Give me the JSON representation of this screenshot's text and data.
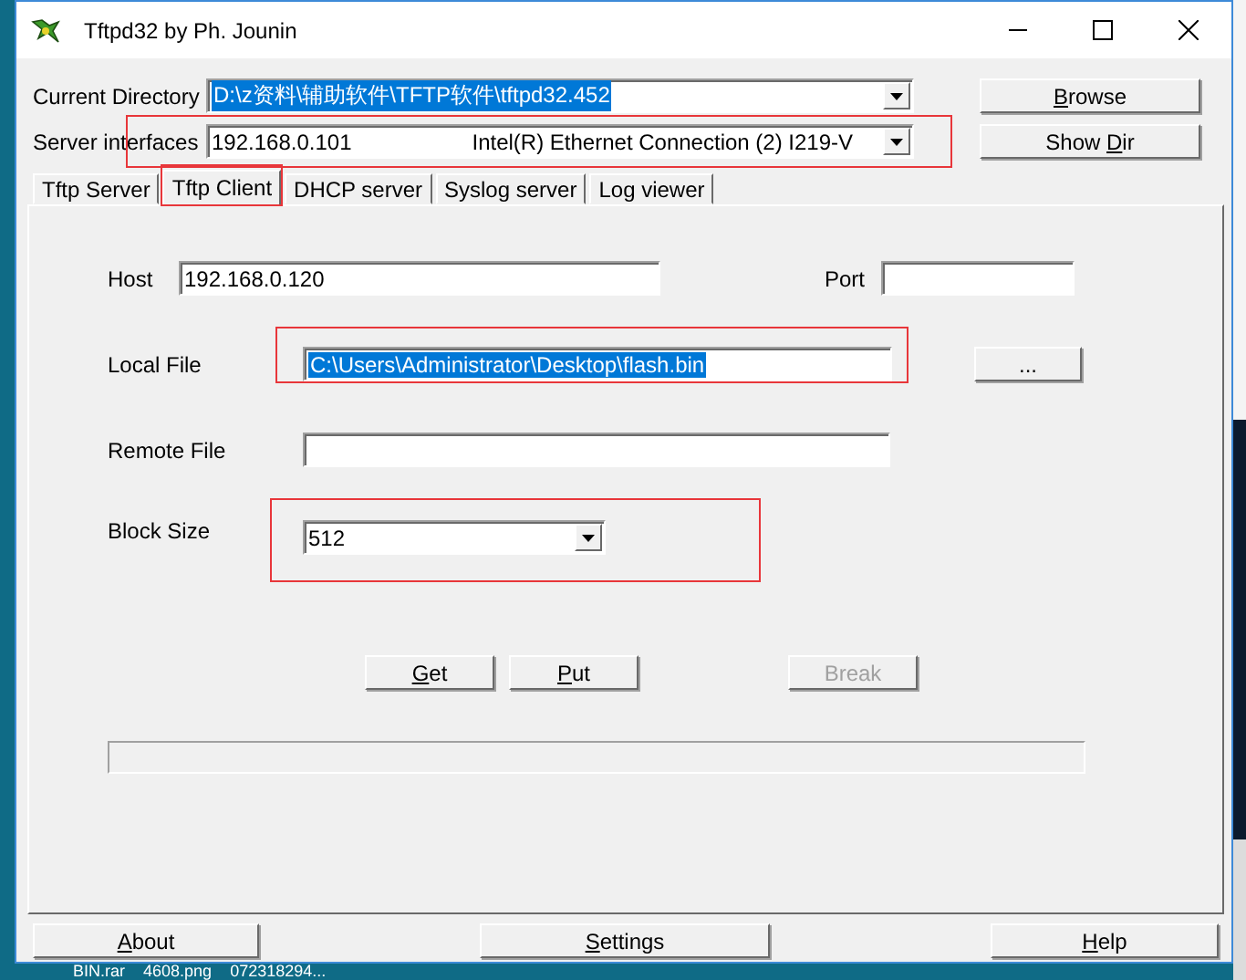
{
  "window": {
    "title": "Tftpd32 by Ph. Jounin"
  },
  "current_directory": {
    "label": "Current Directory",
    "value": "D:\\z资料\\辅助软件\\TFTP软件\\tftpd32.452",
    "selected": true
  },
  "server_interfaces": {
    "label": "Server interfaces",
    "value": "192.168.0.101",
    "adapter": "Intel(R) Ethernet Connection (2) I219-V",
    "highlighted": true
  },
  "side_buttons": [
    {
      "accel": "B",
      "after": "rowse",
      "disabled": false
    },
    {
      "before": "Show ",
      "accel": "D",
      "after": "ir",
      "disabled": false
    }
  ],
  "tabs": [
    {
      "label": "Tftp Server",
      "selected": false,
      "highlighted": false
    },
    {
      "label": "Tftp Client",
      "selected": true,
      "highlighted": true
    },
    {
      "label": "DHCP server",
      "selected": false,
      "highlighted": false
    },
    {
      "label": "Syslog server",
      "selected": false,
      "highlighted": false
    },
    {
      "label": "Log viewer",
      "selected": false,
      "highlighted": false
    }
  ],
  "host": {
    "label": "Host",
    "value": "192.168.0.120"
  },
  "port": {
    "label": "Port"
  },
  "local_file": {
    "label": "Local File",
    "value": "C:\\Users\\Administrator\\Desktop\\flash.bin",
    "selected": true,
    "highlighted": true,
    "browse": "..."
  },
  "remote_file": {
    "label": "Remote File"
  },
  "block_size": {
    "label": "Block Size",
    "value": "512",
    "highlighted": true
  },
  "actions": [
    {
      "accel": "G",
      "after": "et",
      "disabled": false
    },
    {
      "accel": "P",
      "after": "ut",
      "disabled": false
    },
    {
      "after": "Break",
      "disabled": true
    }
  ],
  "progress": {
    "level": 0
  },
  "footer_buttons": [
    {
      "accel": "A",
      "after": "bout",
      "disabled": false
    },
    {
      "accel": "S",
      "after": "ettings",
      "disabled": false
    },
    {
      "accel": "H",
      "after": "elp",
      "disabled": false
    }
  ],
  "desktop_files": [
    "BIN.rar",
    "4608.png",
    "072318294..."
  ]
}
